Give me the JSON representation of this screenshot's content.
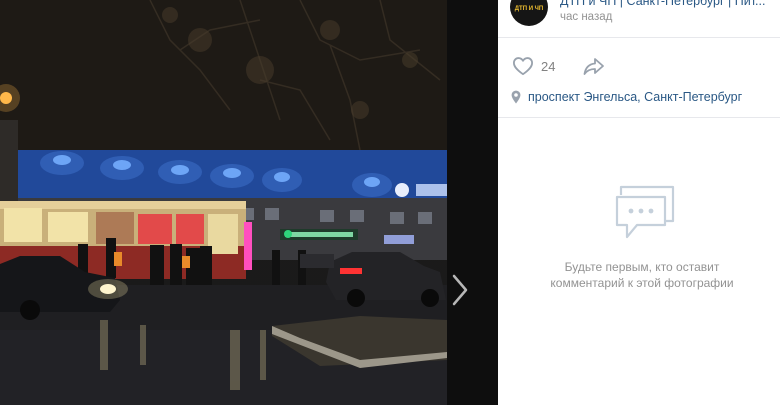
{
  "post": {
    "author": "ДТП и ЧП | Санкт-Петербург | Пит...",
    "time": "час назад",
    "avatar_text": "ДТП И ЧП"
  },
  "actions": {
    "like_icon": "heart-outline-icon",
    "likes": "24",
    "share_icon": "share-arrow-icon"
  },
  "location": {
    "icon": "map-pin-icon",
    "text": "проспект Энгельса, Санкт-Петербург"
  },
  "comments": {
    "icon": "speech-bubble-icon",
    "empty_line1": "Будьте первым, кто оставит",
    "empty_line2": "комментарий к этой фотографии"
  },
  "navigation": {
    "next_icon": "chevron-right-icon"
  },
  "colors": {
    "link": "#2a5885",
    "muted": "#939393",
    "divider": "#e7e8ec",
    "icon": "#99a2ad"
  }
}
